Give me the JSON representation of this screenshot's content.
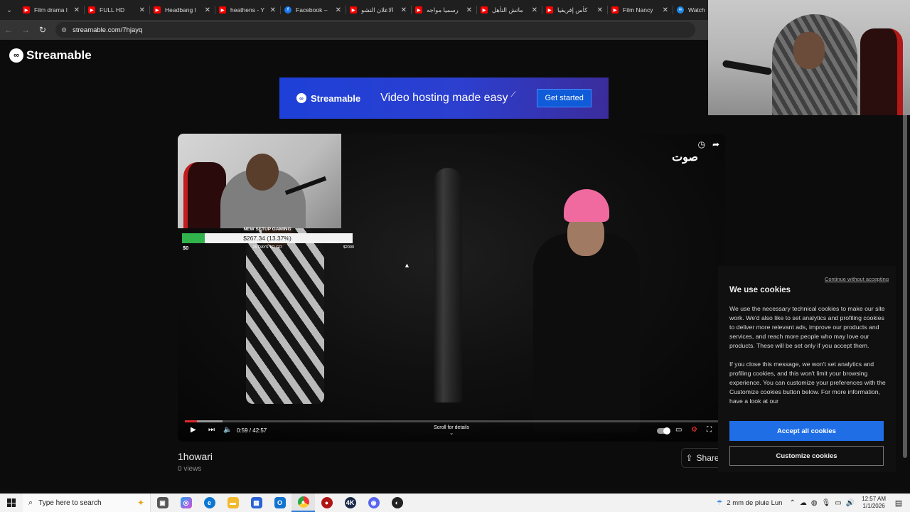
{
  "browser": {
    "tabs": [
      {
        "favicon": "youtube-icon",
        "title": "Film drama l"
      },
      {
        "favicon": "youtube-icon",
        "title": "FULL HD"
      },
      {
        "favicon": "youtube-icon",
        "title": "Headbang l"
      },
      {
        "favicon": "youtube-icon",
        "title": "heathens - Y"
      },
      {
        "favicon": "facebook-icon",
        "title": "Facebook –"
      },
      {
        "favicon": "youtube-icon",
        "title": "الاعلان التشو"
      },
      {
        "favicon": "youtube-icon",
        "title": "رسميا مواجه"
      },
      {
        "favicon": "youtube-icon",
        "title": "ماتش التأهل"
      },
      {
        "favicon": "youtube-icon",
        "title": "كأس إفريقيا"
      },
      {
        "favicon": "youtube-icon",
        "title": "Film Nancy"
      },
      {
        "favicon": "streamable-icon",
        "title": "Watch"
      }
    ],
    "url": "streamable.com/7hjayq"
  },
  "site": {
    "logo_text": "Streamable",
    "banner": {
      "logo_text": "Streamable",
      "tagline": "Video hosting made easy",
      "cta": "Get started"
    }
  },
  "video": {
    "goal_overlay": {
      "title": "NEW SETUP GAMING",
      "amount": "$267.34 (13.37%)",
      "progress": 0.1337,
      "min": "$0",
      "days": "25 DAYS TO GO",
      "max": "$2000"
    },
    "watermark": "صوت",
    "current_time": "0:59",
    "duration": "42:57",
    "time_display": "0:59 / 42:57",
    "played_fraction": 0.023,
    "scroll_hint": "Scroll for details",
    "title": "1howari",
    "views": "0 views",
    "share_label": "Share"
  },
  "cookie_banner": {
    "continue_link": "Continue without accepting",
    "title": "We use cookies",
    "paragraph1": "We use the necessary technical cookies to make our site work. We'd also like to set analytics and profiling cookies to deliver more relevant ads, improve our products and services, and reach more people who may love our products. These will be set only if you accept them.",
    "paragraph2": "If you close this message, we won't set analytics and profiling cookies, and this won't limit your browsing experience. You can customize your preferences with the Customize cookies button below. For more information, have a look at our",
    "accept_label": "Accept all cookies",
    "customize_label": "Customize cookies"
  },
  "taskbar": {
    "search_placeholder": "Type here to search",
    "weather": "2 mm de pluie Lun",
    "time": "12:57 AM",
    "date": "1/1/2026",
    "apps": [
      "task-view-icon",
      "copilot-icon",
      "edge-icon",
      "file-explorer-icon",
      "store-icon",
      "outlook-icon",
      "chrome-icon",
      "app-red-icon",
      "4k-app-icon",
      "discord-icon",
      "obs-icon"
    ]
  }
}
